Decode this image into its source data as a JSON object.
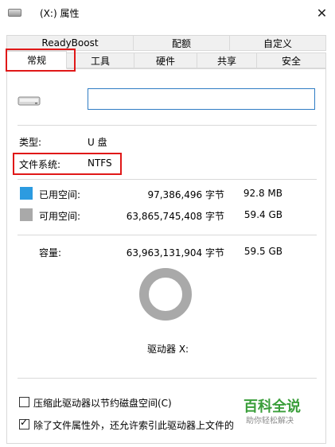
{
  "window": {
    "title": "(X:) 属性",
    "close_glyph": "✕"
  },
  "tabs": {
    "row1": [
      "ReadyBoost",
      "配额",
      "自定义"
    ],
    "row2": [
      "常规",
      "工具",
      "硬件",
      "共享",
      "安全"
    ],
    "active": "常规"
  },
  "general": {
    "volume_label": "",
    "type_label": "类型:",
    "type_value": "U 盘",
    "fs_label": "文件系统:",
    "fs_value": "NTFS",
    "used": {
      "label": "已用空间:",
      "bytes": "97,386,496 字节",
      "human": "92.8 MB",
      "color": "#2c9be0"
    },
    "free": {
      "label": "可用空间:",
      "bytes": "63,865,745,408 字节",
      "human": "59.4 GB",
      "color": "#a9a9a9"
    },
    "capacity": {
      "label": "容量:",
      "bytes": "63,963,131,904 字节",
      "human": "59.5 GB"
    },
    "drive_label": "驱动器 X:",
    "used_fraction": 0.0015
  },
  "options": {
    "compress": {
      "label": "压缩此驱动器以节约磁盘空间(C)",
      "checked": false
    },
    "index": {
      "label": "除了文件属性外，还允许索引此驱动器上文件的",
      "checked": true
    }
  },
  "watermark": {
    "line1": "百科全说",
    "line2": "助你轻松解决"
  },
  "highlight_color": "#e01818"
}
